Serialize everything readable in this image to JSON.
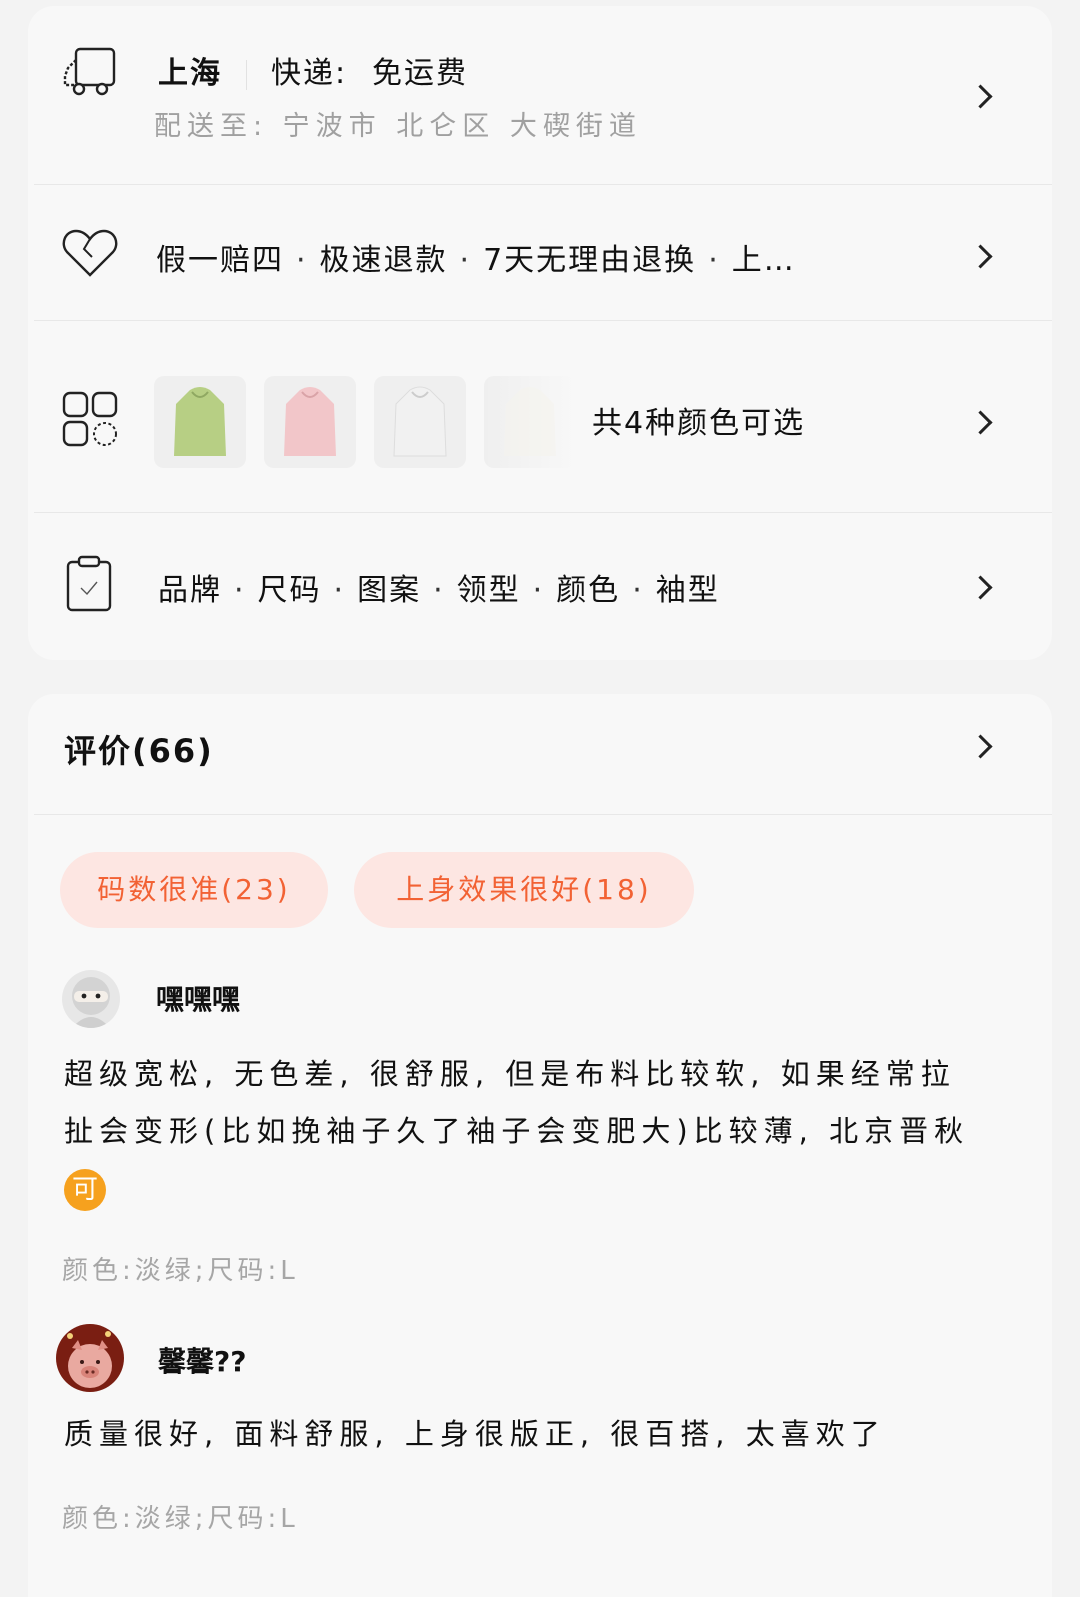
{
  "delivery": {
    "city": "上海",
    "shipping_label": "快递:",
    "shipping_value": "免运费",
    "address": "配送至: 宁波市 北仑区 大碶街道"
  },
  "guarantee": {
    "items": [
      "假一赔四",
      "极速退款",
      "7天无理由退换",
      "上…"
    ]
  },
  "colors": {
    "summary": "共4种颜色可选",
    "swatches": [
      "#b7cf84",
      "#f2c6c9",
      "#f1f1f1",
      "#f5f4ee"
    ]
  },
  "params": {
    "items": [
      "品牌",
      "尺码",
      "图案",
      "领型",
      "颜色",
      "袖型"
    ]
  },
  "reviews": {
    "title": "评价(66)",
    "tags": [
      {
        "label": "码数很准(23)"
      },
      {
        "label": "上身效果很好(18)"
      }
    ],
    "list": [
      {
        "user": "嘿嘿嘿",
        "text": "超级宽松, 无色差, 很舒服, 但是布料比较软, 如果经常拉扯会变形(比如挽袖子久了袖子会变肥大)比较薄, 北京晋秋",
        "emoji": "可",
        "spec": "颜色:淡绿;尺码:L"
      },
      {
        "user": "馨馨??",
        "text": "质量很好, 面料舒服, 上身很版正, 很百搭, 太喜欢了",
        "spec": "颜色:淡绿;尺码:L"
      }
    ]
  }
}
